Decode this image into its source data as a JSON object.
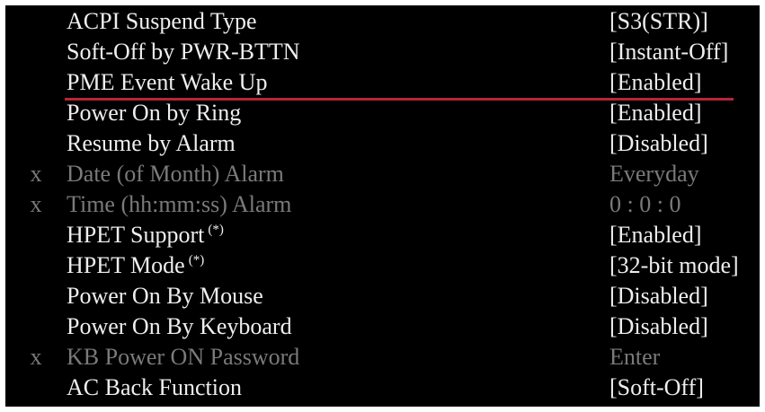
{
  "bios_power_menu": {
    "items": [
      {
        "marker": "",
        "label": "ACPI Suspend Type",
        "suffix": "",
        "value": "[S3(STR)]",
        "enabled": true
      },
      {
        "marker": "",
        "label": "Soft-Off by PWR-BTTN",
        "suffix": "",
        "value": "[Instant-Off]",
        "enabled": true
      },
      {
        "marker": "",
        "label": "PME Event Wake Up",
        "suffix": "",
        "value": "[Enabled]",
        "enabled": true
      },
      {
        "marker": "",
        "label": "Power On by Ring",
        "suffix": "",
        "value": "[Enabled]",
        "enabled": true
      },
      {
        "marker": "",
        "label": "Resume by Alarm",
        "suffix": "",
        "value": "[Disabled]",
        "enabled": true
      },
      {
        "marker": "x",
        "label": "Date (of Month) Alarm",
        "suffix": "",
        "value": "Everyday",
        "enabled": false
      },
      {
        "marker": "x",
        "label": "Time (hh:mm:ss) Alarm",
        "suffix": "",
        "value": "0 : 0 : 0",
        "enabled": false
      },
      {
        "marker": "",
        "label": "HPET Support",
        "suffix": "(*)",
        "value": "[Enabled]",
        "enabled": true
      },
      {
        "marker": "",
        "label": "HPET Mode",
        "suffix": "(*)",
        "value": "[32-bit mode]",
        "enabled": true
      },
      {
        "marker": "",
        "label": "Power On By Mouse",
        "suffix": "",
        "value": "[Disabled]",
        "enabled": true
      },
      {
        "marker": "",
        "label": "Power On By Keyboard",
        "suffix": "",
        "value": "[Disabled]",
        "enabled": true
      },
      {
        "marker": "x",
        "label": "KB Power ON Password",
        "suffix": "",
        "value": "Enter",
        "enabled": false
      },
      {
        "marker": "",
        "label": "AC Back Function",
        "suffix": "",
        "value": "[Soft-Off]",
        "enabled": true
      }
    ],
    "highlighted_index": 2,
    "highlight_color": "#b7253a",
    "text_color": "#eeeeee",
    "disabled_color": "#7a7a7a",
    "background_color": "#000000"
  }
}
